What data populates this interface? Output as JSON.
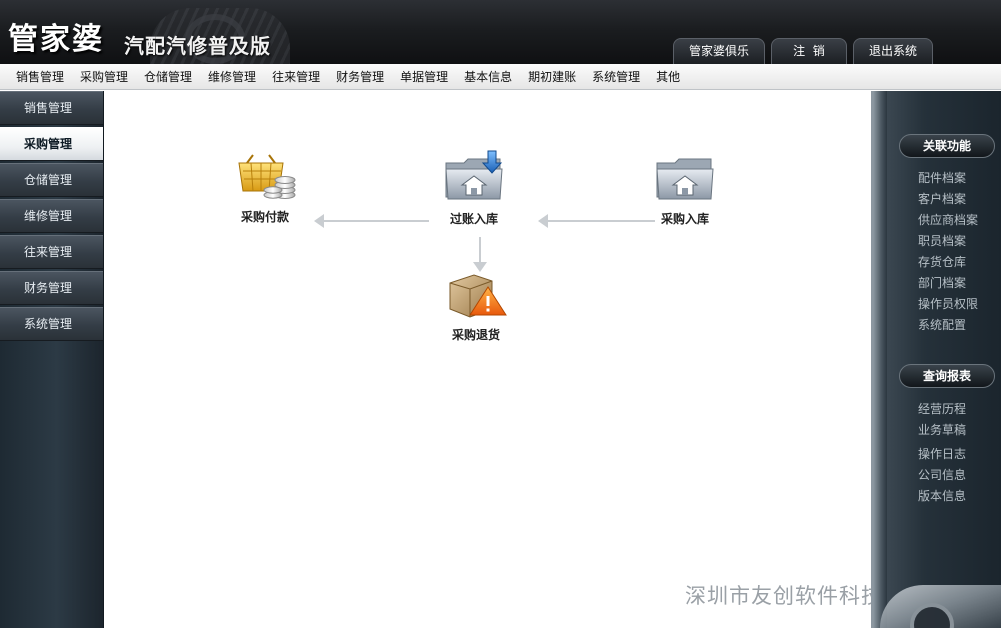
{
  "header": {
    "logo_main": "管家婆",
    "logo_sub": "汽配汽修普及版",
    "top_links": [
      "管家婆俱乐部",
      "注  销",
      "退出系统"
    ]
  },
  "menubar": {
    "items": [
      "销售管理",
      "采购管理",
      "仓储管理",
      "维修管理",
      "往来管理",
      "财务管理",
      "单据管理",
      "基本信息",
      "期初建账",
      "系统管理",
      "其他"
    ]
  },
  "sidebar_left": {
    "items": [
      {
        "label": "销售管理",
        "active": false
      },
      {
        "label": "采购管理",
        "active": true
      },
      {
        "label": "仓储管理",
        "active": false
      },
      {
        "label": "维修管理",
        "active": false
      },
      {
        "label": "往来管理",
        "active": false
      },
      {
        "label": "财务管理",
        "active": false
      },
      {
        "label": "系统管理",
        "active": false
      }
    ]
  },
  "flow": {
    "payment": {
      "label": "采购付款",
      "icon": "shopping-basket-coins-icon"
    },
    "posting": {
      "label": "过账入库",
      "icon": "folder-home-down-arrow-icon"
    },
    "stockin": {
      "label": "采购入库",
      "icon": "folder-home-icon"
    },
    "return": {
      "label": "采购退货",
      "icon": "box-warning-icon"
    }
  },
  "sidebar_right": {
    "section1_title": "关联功能",
    "section1_links": [
      "配件档案",
      "客户档案",
      "供应商档案",
      "职员档案",
      "存货仓库",
      "部门档案",
      "操作员权限",
      "系统配置"
    ],
    "section2_title": "查询报表",
    "section2_links": [
      "经营历程",
      "业务草稿",
      "操作日志",
      "公司信息",
      "版本信息"
    ]
  },
  "watermark": "深圳市友创软件科技有限公司",
  "colors": {
    "header_bg": "#1b1d20",
    "sidebar_bg": "#2c3a45",
    "active_item_bg": "#ffffff",
    "arrow": "#c9cdd1"
  }
}
